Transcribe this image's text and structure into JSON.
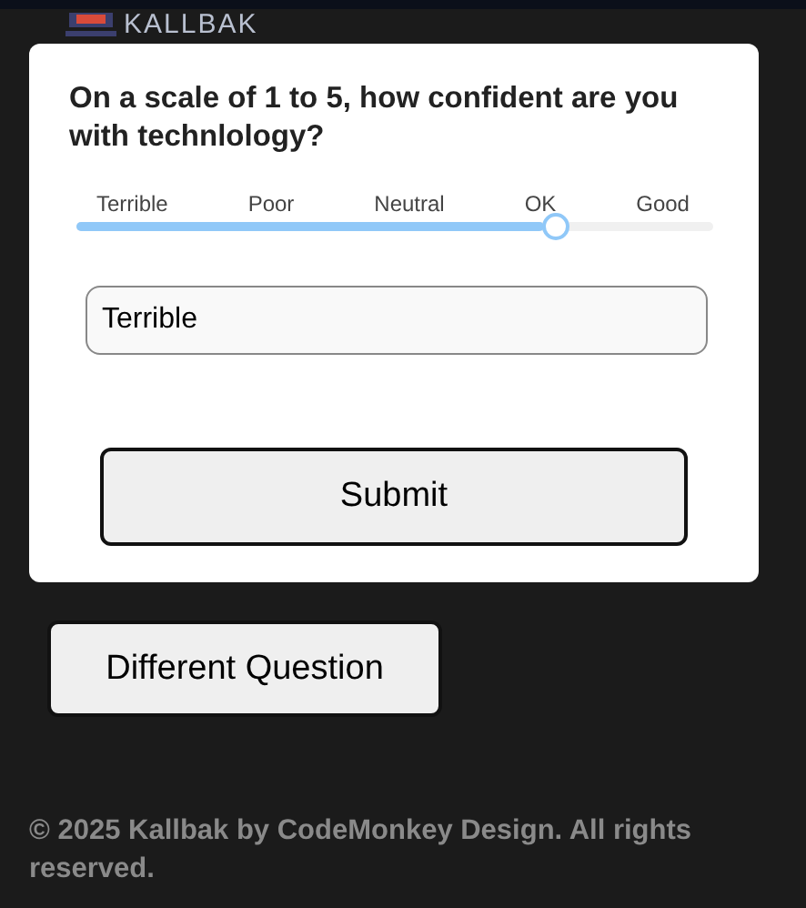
{
  "logo": {
    "text": "KALLBAK"
  },
  "question": "On a scale of 1 to 5, how confident are you with technlology?",
  "scale": {
    "labels": [
      "Terrible",
      "Poor",
      "Neutral",
      "OK",
      "Good"
    ],
    "level": 0.75
  },
  "answer": {
    "value": "Terrible"
  },
  "submit": "Submit",
  "other_button": "Different Question",
  "footer": "© 2025 Kallbak by CodeMonkey Design. All rights reserved."
}
